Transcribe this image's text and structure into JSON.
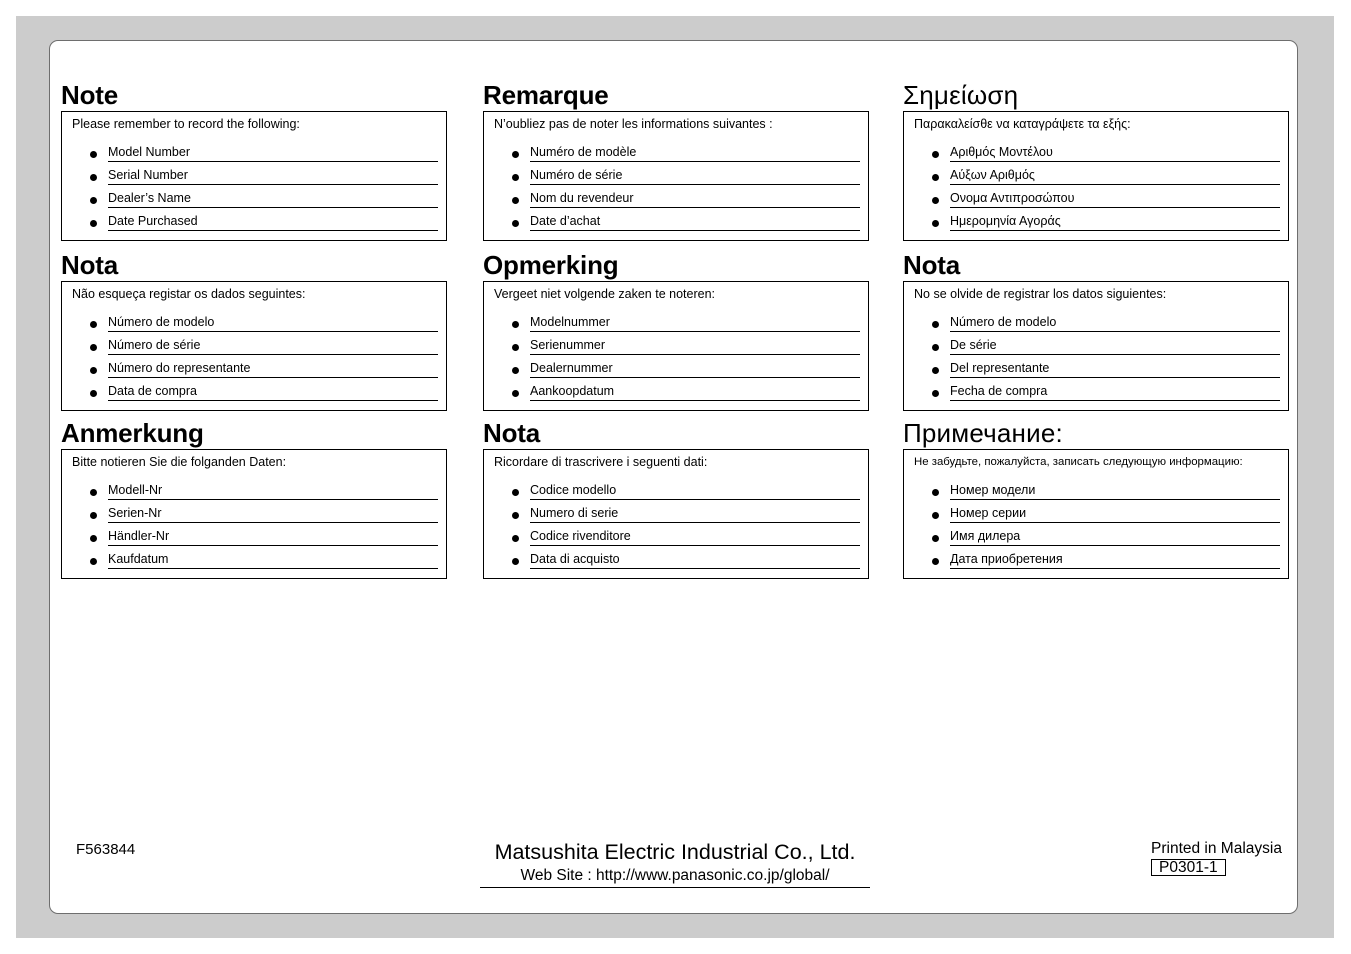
{
  "sections": [
    {
      "title": "Note",
      "intro": "Please remember to record the following:",
      "items": [
        "Model Number",
        "Serial Number",
        "Dealer’s Name",
        "Date Purchased"
      ]
    },
    {
      "title": "Remarque",
      "intro": "N’oubliez pas de noter les informations suivantes :",
      "items": [
        "Numéro de modèle",
        "Numéro de série",
        "Nom du revendeur",
        "Date d’achat"
      ]
    },
    {
      "title": "Σημείωση",
      "intro": "Παρακαλείσθε να καταγράψετε τα εξής:",
      "items": [
        "Αριθμός Μοντέλου",
        "Αύξων Αριθμός",
        "Ονομα Αντιπροσώπου",
        "Ημερομηνία Αγοράς"
      ]
    },
    {
      "title": "Nota",
      "intro": "Não esqueça registar os dados seguintes:",
      "items": [
        "Número de modelo",
        "Número de série",
        "Número do representante",
        "Data de compra"
      ]
    },
    {
      "title": "Opmerking",
      "intro": "Vergeet niet volgende zaken  te noteren:",
      "items": [
        "Modelnummer",
        "Serienummer",
        "Dealernummer",
        "Aankoopdatum"
      ]
    },
    {
      "title": "Nota",
      "intro": "No se olvide de registrar los datos siguientes:",
      "items": [
        "Número de modelo",
        "De série",
        "Del representante",
        "Fecha de compra"
      ]
    },
    {
      "title": "Anmerkung",
      "intro": "Bitte notieren Sie die folganden Daten:",
      "items": [
        "Modell-Nr",
        "Serien-Nr",
        "Händler-Nr",
        "Kaufdatum"
      ]
    },
    {
      "title": "Nota",
      "intro": "Ricordare di trascrivere i seguenti dati:",
      "items": [
        "Codice modello",
        "Numero di serie",
        "Codice rivenditore",
        "Data di acquisto"
      ]
    },
    {
      "title": "Примечание:",
      "intro": "Не забудьте, пожалуйста, записать следующую информацию:",
      "items": [
        "Номер модели",
        "Номер серии",
        "Имя дилера",
        "Дата приобретения"
      ]
    }
  ],
  "footer": {
    "document_code": "F563844",
    "company": "Matsushita Electric Industrial Co., Ltd.",
    "website": "Web Site : http://www.panasonic.co.jp/global/",
    "printed_in": "Printed in Malaysia",
    "print_code": "P0301-1"
  }
}
